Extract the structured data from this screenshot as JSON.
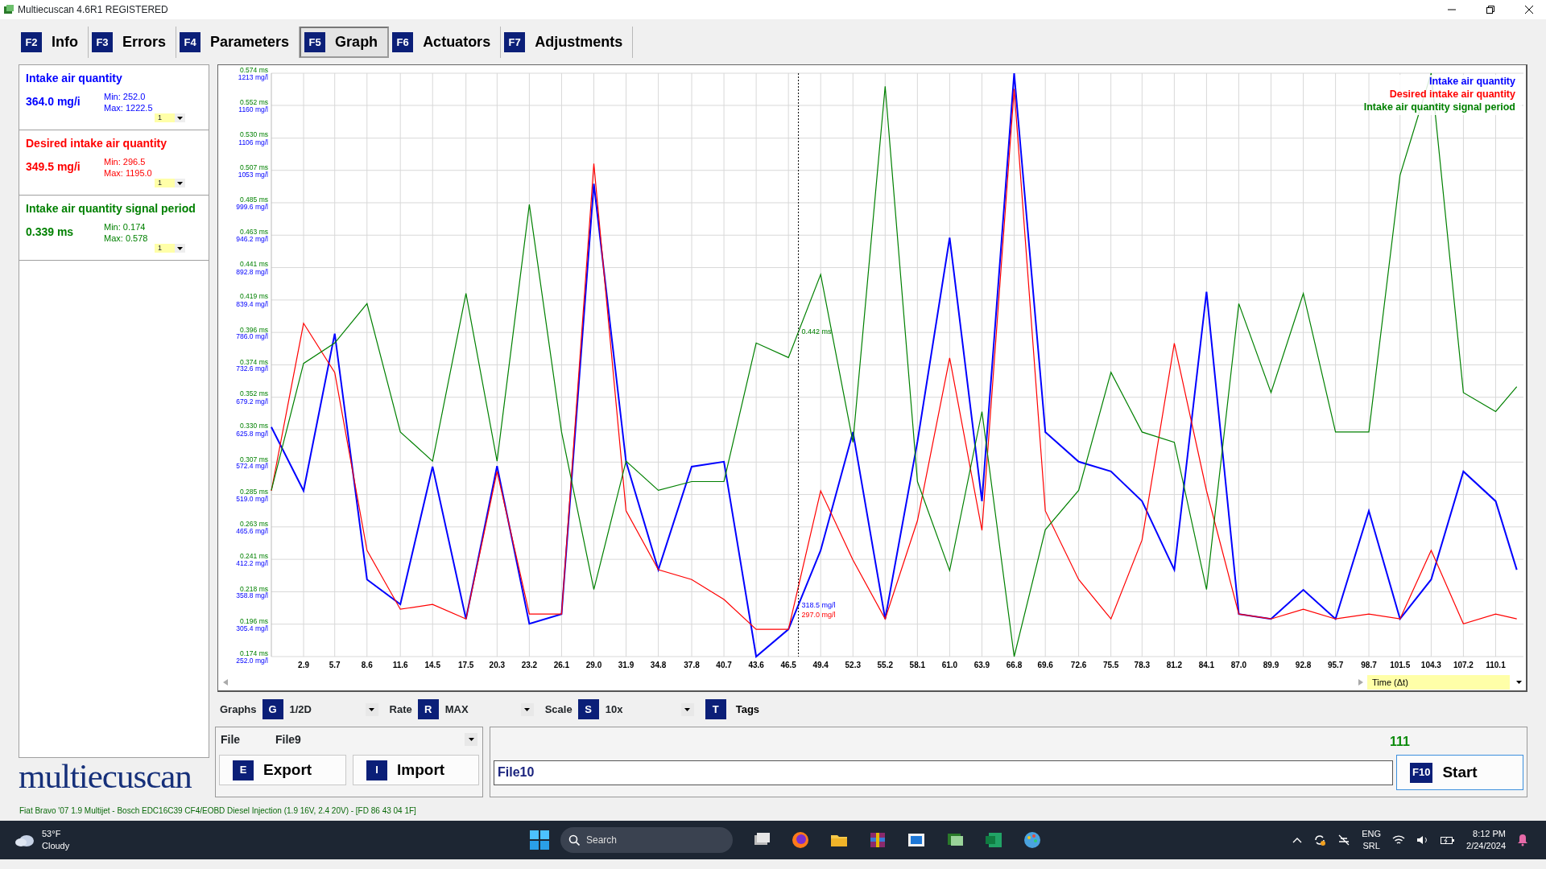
{
  "window": {
    "title": "Multiecuscan 4.6R1 REGISTERED"
  },
  "tabs": [
    {
      "key": "F2",
      "label": "Info",
      "selected": false
    },
    {
      "key": "F3",
      "label": "Errors",
      "selected": false
    },
    {
      "key": "F4",
      "label": "Parameters",
      "selected": false
    },
    {
      "key": "F5",
      "label": "Graph",
      "selected": true
    },
    {
      "key": "F6",
      "label": "Actuators",
      "selected": false
    },
    {
      "key": "F7",
      "label": "Adjustments",
      "selected": false
    }
  ],
  "sensors": [
    {
      "name": "Intake air quantity",
      "value": "364.0 mg/i",
      "min": "Min: 252.0",
      "max": "Max: 1222.5",
      "scale": "1",
      "color": "#0000ff"
    },
    {
      "name": "Desired intake air quantity",
      "value": "349.5 mg/i",
      "min": "Min: 296.5",
      "max": "Max: 1195.0",
      "scale": "1",
      "color": "#ff0000"
    },
    {
      "name": "Intake air quantity signal period",
      "value": "0.339 ms",
      "min": "Min: 0.174",
      "max": "Max: 0.578",
      "scale": "1",
      "color": "#008000"
    }
  ],
  "logo": "multiecuscan",
  "graph": {
    "axis_selector": "Time (Δt)",
    "chart_data": {
      "type": "line",
      "x": [
        0,
        2.9,
        5.7,
        8.6,
        11.6,
        14.5,
        17.5,
        20.3,
        23.2,
        26.1,
        29.0,
        31.9,
        34.8,
        37.8,
        40.7,
        43.6,
        46.5,
        49.4,
        52.3,
        55.2,
        58.1,
        61.0,
        63.9,
        66.8,
        69.6,
        72.6,
        75.5,
        78.3,
        81.2,
        84.1,
        87.0,
        89.9,
        92.8,
        95.7,
        98.7,
        101.5,
        104.3,
        107.2,
        110.1,
        112.0
      ],
      "xlim": [
        0,
        112.6
      ],
      "ylim": [
        252.0,
        1213
      ],
      "y2lim": [
        0.174,
        0.574
      ],
      "grid": true,
      "xticks": [
        2.9,
        5.7,
        8.6,
        11.6,
        14.5,
        17.5,
        20.3,
        23.2,
        26.1,
        {
          "value": 29,
          "label": "29.0"
        },
        31.9,
        34.8,
        37.8,
        40.7,
        43.6,
        46.5,
        49.4,
        52.3,
        55.2,
        58.1,
        {
          "value": 61,
          "label": "61.0"
        },
        63.9,
        66.8,
        69.6,
        72.6,
        75.5,
        78.3,
        81.2,
        84.1,
        {
          "value": 87,
          "label": "87.0"
        },
        89.9,
        92.8,
        95.7,
        98.7,
        101.5,
        104.3,
        107.2,
        110.1
      ],
      "yticks": [
        {
          "value": 1213,
          "label": "1213 mg/l"
        },
        {
          "value": 1160,
          "label": "1160 mg/l"
        },
        {
          "value": 1106,
          "label": "1106 mg/l"
        },
        {
          "value": 1053,
          "label": "1053 mg/l"
        },
        {
          "value": 999.6,
          "label": "999.6 mg/l"
        },
        {
          "value": 946.2,
          "label": "946.2 mg/l"
        },
        {
          "value": 892.8,
          "label": "892.8 mg/l"
        },
        {
          "value": 839.4,
          "label": "839.4 mg/l"
        },
        {
          "value": 786.0,
          "label": "786.0 mg/l"
        },
        {
          "value": 732.6,
          "label": "732.6 mg/l"
        },
        {
          "value": 679.2,
          "label": "679.2 mg/l"
        },
        {
          "value": 625.8,
          "label": "625.8 mg/l"
        },
        {
          "value": 572.4,
          "label": "572.4 mg/l"
        },
        {
          "value": 519.0,
          "label": "519.0 mg/l"
        },
        {
          "value": 465.6,
          "label": "465.6 mg/l"
        },
        {
          "value": 412.2,
          "label": "412.2 mg/l"
        },
        {
          "value": 358.8,
          "label": "358.8 mg/l"
        },
        {
          "value": 305.4,
          "label": "305.4 mg/l"
        },
        {
          "value": 252.0,
          "label": "252.0 mg/l"
        }
      ],
      "y2ticks": [
        {
          "value": 0.574,
          "label": "0.574 ms"
        },
        {
          "value": 0.552,
          "label": "0.552 ms"
        },
        {
          "value": 0.53,
          "label": "0.530 ms"
        },
        {
          "value": 0.507,
          "label": "0.507 ms"
        },
        {
          "value": 0.485,
          "label": "0.485 ms"
        },
        {
          "value": 0.463,
          "label": "0.463 ms"
        },
        {
          "value": 0.441,
          "label": "0.441 ms"
        },
        {
          "value": 0.419,
          "label": "0.419 ms"
        },
        {
          "value": 0.396,
          "label": "0.396 ms"
        },
        {
          "value": 0.374,
          "label": "0.374 ms"
        },
        {
          "value": 0.352,
          "label": "0.352 ms"
        },
        {
          "value": 0.33,
          "label": "0.330 ms"
        },
        {
          "value": 0.307,
          "label": "0.307 ms"
        },
        {
          "value": 0.285,
          "label": "0.285 ms"
        },
        {
          "value": 0.263,
          "label": "0.263 ms"
        },
        {
          "value": 0.241,
          "label": "0.241 ms"
        },
        {
          "value": 0.218,
          "label": "0.218 ms"
        },
        {
          "value": 0.196,
          "label": "0.196 ms"
        },
        {
          "value": 0.174,
          "label": "0.174 ms"
        }
      ],
      "series": [
        {
          "name": "Intake air quantity",
          "color": "#0000ff",
          "axis": "y",
          "values": [
            630,
            525,
            784,
            379,
            338,
            565,
            314,
            566,
            306,
            322,
            1031,
            573,
            395,
            565,
            573,
            252,
            297,
            427,
            622,
            314,
            606,
            942,
            508,
            1213,
            622,
            573,
            557,
            508,
            395,
            853,
            322,
            314,
            362,
            314,
            492,
            314,
            379,
            557,
            508,
            395
          ]
        },
        {
          "name": "Desired intake air quantity",
          "color": "#ff0000",
          "axis": "y",
          "values": [
            525,
            801,
            720,
            427,
            330,
            338,
            314,
            557,
            322,
            322,
            1064,
            492,
            395,
            379,
            346,
            297,
            297,
            525,
            411,
            314,
            476,
            744,
            460,
            1187,
            492,
            379,
            314,
            444,
            768,
            525,
            322,
            314,
            330,
            314,
            322,
            314,
            427,
            306,
            322,
            314
          ]
        },
        {
          "name": "Intake air quantity signal period",
          "color": "#008000",
          "axis": "y2",
          "values": [
            0.288,
            0.375,
            0.389,
            0.416,
            0.328,
            0.308,
            0.423,
            0.308,
            0.484,
            0.328,
            0.22,
            0.308,
            0.288,
            0.294,
            0.294,
            0.389,
            0.379,
            0.436,
            0.321,
            0.565,
            0.294,
            0.233,
            0.342,
            0.174,
            0.261,
            0.288,
            0.369,
            0.328,
            0.321,
            0.22,
            0.416,
            0.355,
            0.423,
            0.328,
            0.328,
            0.504,
            0.574,
            0.355,
            0.342,
            0.359
          ]
        }
      ],
      "ref_lines": [
        {
          "value": 47.4,
          "axis": "x"
        }
      ],
      "annotations": [
        "318.5 mg/l",
        "297.0 mg/l",
        "0.442 ms"
      ]
    }
  },
  "controls": [
    {
      "kind": "dropdown",
      "label": "Graphs",
      "key": "G",
      "value": "1/2D"
    },
    {
      "kind": "dropdown",
      "label": "Rate",
      "key": "R",
      "value": "MAX"
    },
    {
      "kind": "dropdown",
      "label": "Scale",
      "key": "S",
      "value": "10x"
    },
    {
      "kind": "button",
      "key": "T",
      "label": "Tags"
    }
  ],
  "file": {
    "label": "File",
    "value": "File9"
  },
  "buttons": [
    {
      "key": "E",
      "label": "Export"
    },
    {
      "key": "I",
      "label": "Import"
    }
  ],
  "counter": "111",
  "filename": {
    "value": "File10"
  },
  "start": {
    "key": "F10",
    "label": "Start"
  },
  "status_bar": "Fiat Bravo '07 1.9 Multijet - Bosch EDC16C39 CF4/EOBD Diesel Injection (1.9 16V, 2.4 20V) - [FD 86 43 04 1F]",
  "taskbar": {
    "weather": {
      "temp": "53°F",
      "text": "Cloudy"
    },
    "search": {
      "placeholder": "Search"
    },
    "tray": {
      "lang": "ENG",
      "layout": "SRL",
      "time": "8:12 PM",
      "date": "2/24/2024"
    }
  }
}
